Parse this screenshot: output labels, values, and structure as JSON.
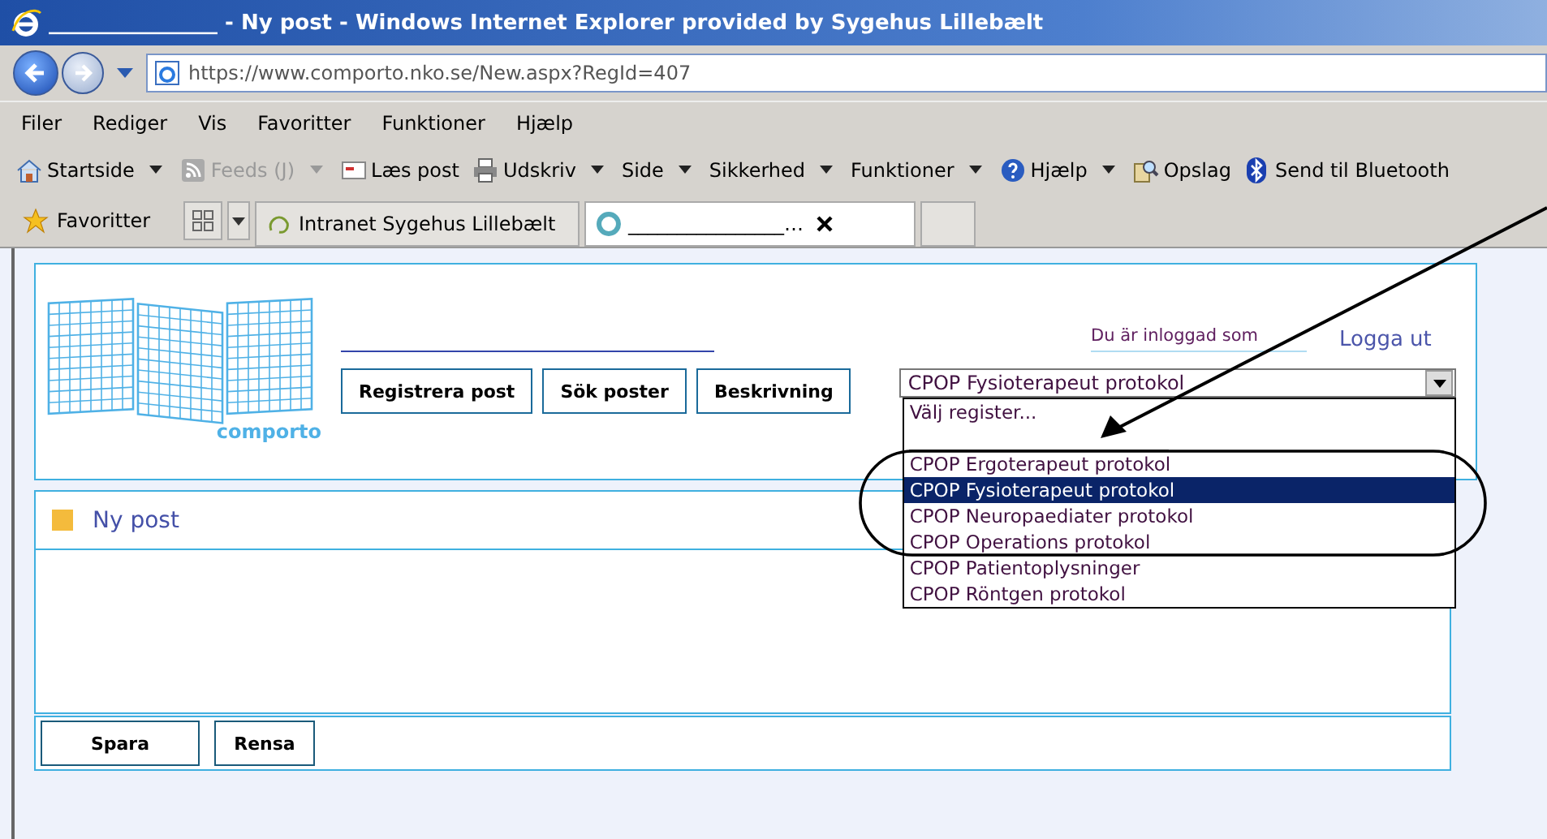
{
  "window": {
    "title": "________________ - Ny post - Windows Internet Explorer provided by Sygehus Lillebælt"
  },
  "address_bar": {
    "url": "https://www.comporto.nko.se/New.aspx?RegId=407"
  },
  "menu": [
    "Filer",
    "Rediger",
    "Vis",
    "Favoritter",
    "Funktioner",
    "Hjælp"
  ],
  "command_bar": [
    {
      "label": "Startside",
      "kind": "home",
      "disabled": false,
      "dropdown": true
    },
    {
      "label": "Feeds (J)",
      "kind": "feed",
      "disabled": true,
      "dropdown": true
    },
    {
      "label": "Læs post",
      "kind": "mail",
      "disabled": false,
      "dropdown": false
    },
    {
      "label": "Udskriv",
      "kind": "print",
      "disabled": false,
      "dropdown": true
    },
    {
      "label": "Side",
      "kind": "text",
      "disabled": false,
      "dropdown": true
    },
    {
      "label": "Sikkerhed",
      "kind": "text",
      "disabled": false,
      "dropdown": true
    },
    {
      "label": "Funktioner",
      "kind": "text",
      "disabled": false,
      "dropdown": true
    },
    {
      "label": "Hjælp",
      "kind": "help",
      "disabled": false,
      "dropdown": true
    },
    {
      "label": "Opslag",
      "kind": "research",
      "disabled": false,
      "dropdown": false
    },
    {
      "label": "Send til Bluetooth",
      "kind": "bluetooth",
      "disabled": false,
      "dropdown": false
    }
  ],
  "favorites_bar": {
    "label": "Favoritter",
    "tabs": [
      {
        "title": "Intranet Sygehus Lillebælt",
        "selected": false
      },
      {
        "title": "________________…",
        "selected": true
      }
    ]
  },
  "page": {
    "logo_text": "comporto",
    "login_text": "Du är inloggad som",
    "logout_link": "Logga ut",
    "nav_buttons": [
      "Registrera post",
      "Sök poster",
      "Beskrivning"
    ],
    "register_select": {
      "value": "CPOP Fysioterapeut protokol",
      "expanded": true,
      "options": [
        {
          "kind": "option",
          "label": "Välj register...",
          "selected": false
        },
        {
          "kind": "separator"
        },
        {
          "kind": "option",
          "label": "CPOP Ergoterapeut protokol",
          "selected": false
        },
        {
          "kind": "option",
          "label": "CPOP Fysioterapeut protokol",
          "selected": true
        },
        {
          "kind": "option",
          "label": "CPOP Neuropaediater protokol",
          "selected": false
        },
        {
          "kind": "option",
          "label": "CPOP Operations protokol",
          "selected": false
        },
        {
          "kind": "option",
          "label": "CPOP Patientoplysninger",
          "selected": false
        },
        {
          "kind": "option",
          "label": "CPOP Röntgen protokol",
          "selected": false
        }
      ]
    },
    "section_title": "Ny post",
    "form_buttons": [
      "Spara",
      "Rensa"
    ]
  }
}
